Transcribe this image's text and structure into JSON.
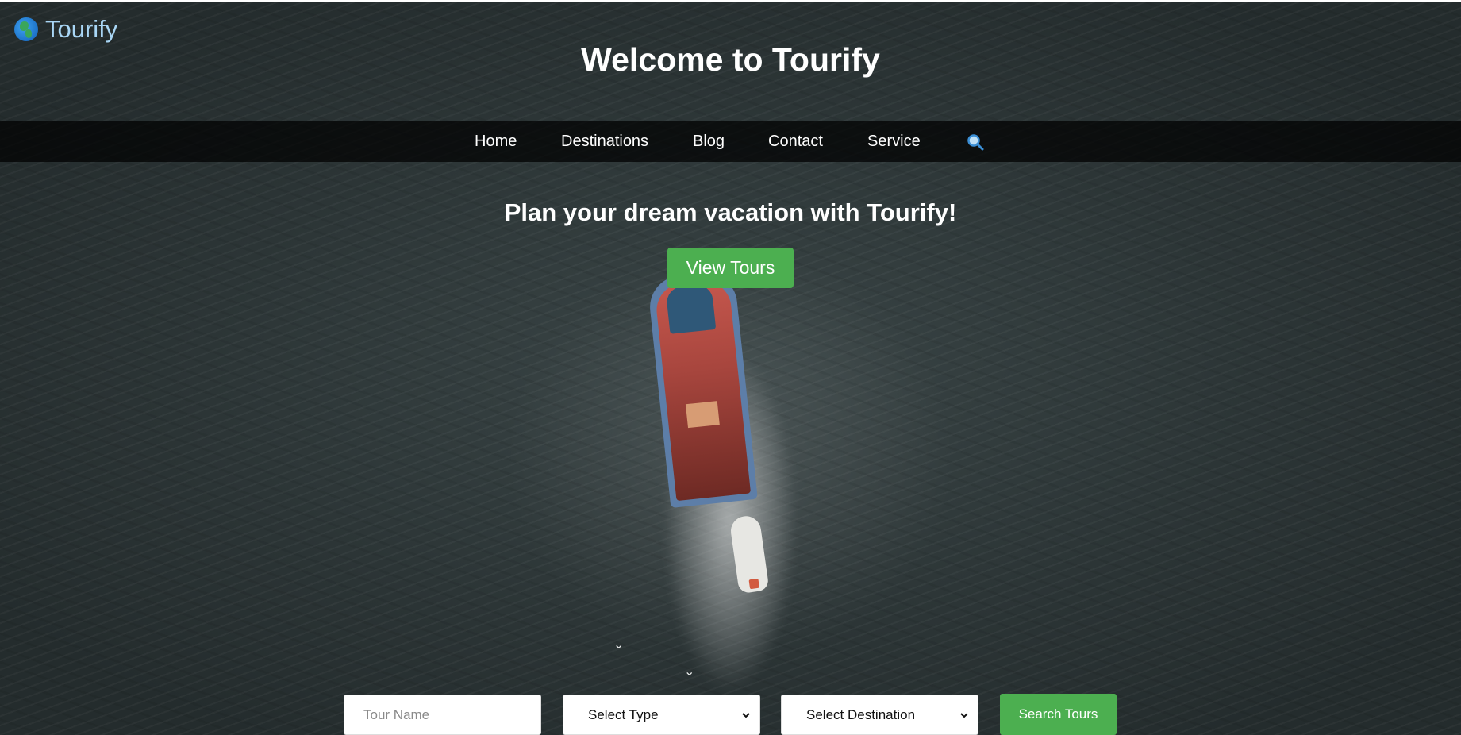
{
  "brand": {
    "name": "Tourify",
    "logo_icon": "globe-icon"
  },
  "hero": {
    "title": "Welcome to Tourify",
    "tagline": "Plan your dream vacation with Tourify!",
    "cta_label": "View Tours",
    "background": "aerial ocean with fishing boat"
  },
  "nav": {
    "items": [
      {
        "label": "Home"
      },
      {
        "label": "Destinations"
      },
      {
        "label": "Blog"
      },
      {
        "label": "Contact"
      },
      {
        "label": "Service"
      }
    ],
    "search_icon": "magnifier-icon"
  },
  "search": {
    "tour_name_placeholder": "Tour Name",
    "type_selected": "Select Type",
    "destination_selected": "Select Destination",
    "button_label": "Search Tours"
  },
  "colors": {
    "accent_green": "#4caf50",
    "logo_text": "#a9d6f5",
    "nav_bg": "#000000",
    "search_icon": "#3b8fd6"
  }
}
